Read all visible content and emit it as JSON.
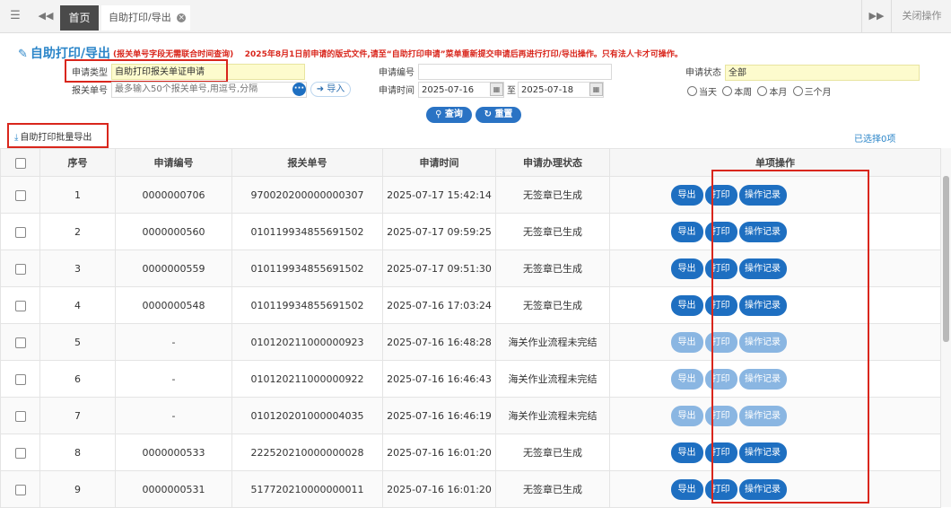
{
  "tabbar": {
    "menu_icon": "hamburger-icon",
    "prev_icon": "double-left-icon",
    "home_label": "首页",
    "active_tab_label": "自助打印/导出",
    "close_icon": "close-circle-icon",
    "next_icon": "double-right-icon",
    "close_ops_label": "关闭操作"
  },
  "page": {
    "title": "自助打印/导出",
    "title_icon": "edit-icon",
    "notice_hint": "(报关单号字段无需联合时间查询)",
    "notice": "2025年8月1日前申请的版式文件,请至“自助打印申请”菜单重新提交申请后再进行打印/导出操作。只有法人卡才可操作。"
  },
  "form": {
    "apply_type_label": "申请类型",
    "apply_type_value": "自助打印报关单证申请",
    "apply_no_label": "申请编号",
    "apply_no_value": "",
    "status_label": "申请状态",
    "status_value": "全部",
    "decl_no_label": "报关单号",
    "decl_no_placeholder": "最多输入50个报关单号,用逗号,分隔",
    "import_label": "导入",
    "time_label": "申请时间",
    "date_from": "2025-07-16",
    "to_label": "至",
    "date_to": "2025-07-18",
    "radios": [
      "当天",
      "本周",
      "本月",
      "三个月"
    ],
    "query_label": "查询",
    "reset_label": "重置"
  },
  "toolbar": {
    "batch_export_label": "自助打印批量导出",
    "selected_text": "已选择0项"
  },
  "table": {
    "headers": [
      "序号",
      "申请编号",
      "报关单号",
      "申请时间",
      "申请办理状态",
      "单项操作"
    ],
    "action_labels": [
      "导出",
      "打印",
      "操作记录"
    ],
    "rows": [
      {
        "no": "1",
        "apply_no": "0000000706",
        "decl_no": "970020200000000307",
        "time": "2025-07-17 15:42:14",
        "status": "无签章已生成",
        "enabled": true
      },
      {
        "no": "2",
        "apply_no": "0000000560",
        "decl_no": "010119934855691502",
        "time": "2025-07-17 09:59:25",
        "status": "无签章已生成",
        "enabled": true
      },
      {
        "no": "3",
        "apply_no": "0000000559",
        "decl_no": "010119934855691502",
        "time": "2025-07-17 09:51:30",
        "status": "无签章已生成",
        "enabled": true
      },
      {
        "no": "4",
        "apply_no": "0000000548",
        "decl_no": "010119934855691502",
        "time": "2025-07-16 17:03:24",
        "status": "无签章已生成",
        "enabled": true
      },
      {
        "no": "5",
        "apply_no": "-",
        "decl_no": "010120211000000923",
        "time": "2025-07-16 16:48:28",
        "status": "海关作业流程未完结",
        "enabled": false
      },
      {
        "no": "6",
        "apply_no": "-",
        "decl_no": "010120211000000922",
        "time": "2025-07-16 16:46:43",
        "status": "海关作业流程未完结",
        "enabled": false
      },
      {
        "no": "7",
        "apply_no": "-",
        "decl_no": "010120201000004035",
        "time": "2025-07-16 16:46:19",
        "status": "海关作业流程未完结",
        "enabled": false
      },
      {
        "no": "8",
        "apply_no": "0000000533",
        "decl_no": "222520210000000028",
        "time": "2025-07-16 16:01:20",
        "status": "无签章已生成",
        "enabled": true
      },
      {
        "no": "9",
        "apply_no": "0000000531",
        "decl_no": "517720210000000011",
        "time": "2025-07-16 16:01:20",
        "status": "无签章已生成",
        "enabled": true
      }
    ]
  },
  "colors": {
    "accent": "#1e6fc1",
    "accent_disabled": "#8ab6e2",
    "highlight_box": "#d9261c",
    "title": "#2c86c9"
  }
}
